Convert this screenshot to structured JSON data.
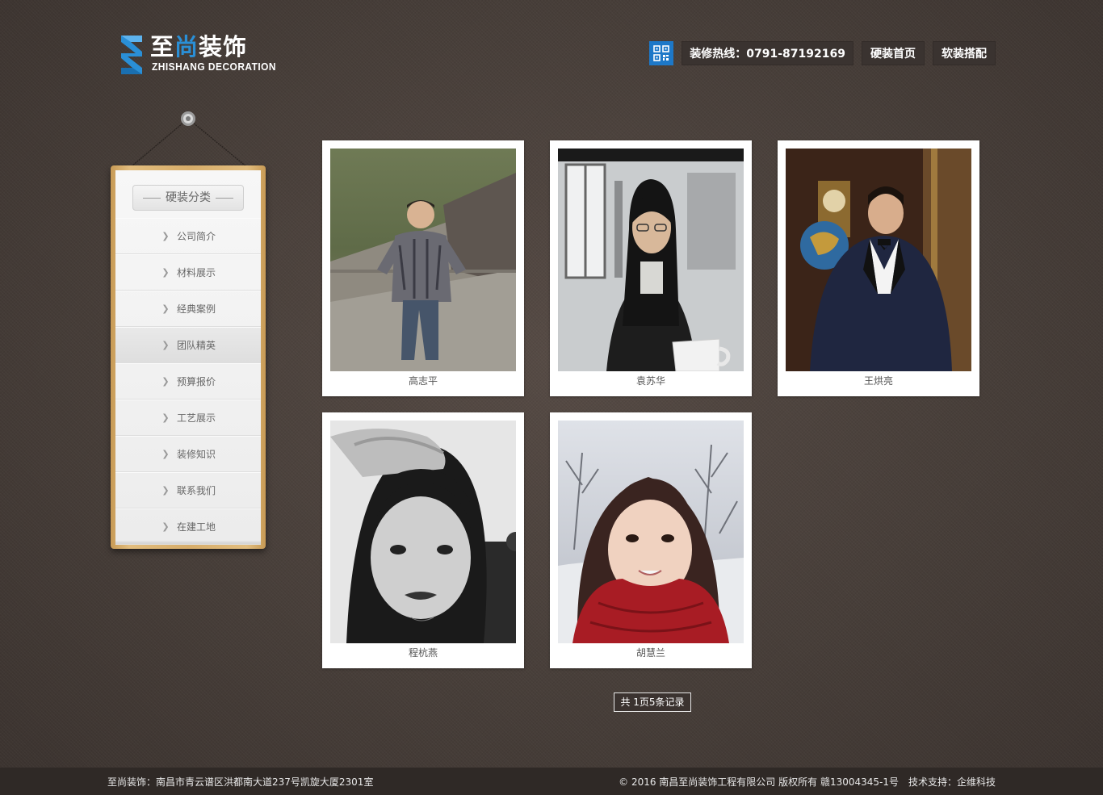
{
  "logo": {
    "cn_main": "至",
    "cn_highlight": "尚",
    "cn_rest": "装饰",
    "en": "ZHISHANG DECORATION"
  },
  "nav": {
    "hotline": "装修热线：0791-87192169",
    "items": [
      "硬装首页",
      "软装搭配"
    ]
  },
  "sidebar": {
    "title": "硬装分类",
    "items": [
      "公司简介",
      "材料展示",
      "经典案例",
      "团队精英",
      "预算报价",
      "工艺展示",
      "装修知识",
      "联系我们",
      "在建工地"
    ],
    "active": "团队精英"
  },
  "team": [
    {
      "name": "高志平"
    },
    {
      "name": "袁苏华"
    },
    {
      "name": "王烘亮"
    },
    {
      "name": "程杭燕"
    },
    {
      "name": "胡慧兰"
    }
  ],
  "pager": "共 1页5条记录",
  "footer": {
    "address": "至尚装饰：南昌市青云谱区洪都南大道237号凯旋大厦2301室",
    "copyright": "© 2016 南昌至尚装饰工程有限公司 版权所有 赣13004345-1号",
    "support": "技术支持：企维科技"
  },
  "colors": {
    "brand_blue": "#2a8fd6",
    "qr_blue": "#1d78c8",
    "background": "#4a403b"
  }
}
